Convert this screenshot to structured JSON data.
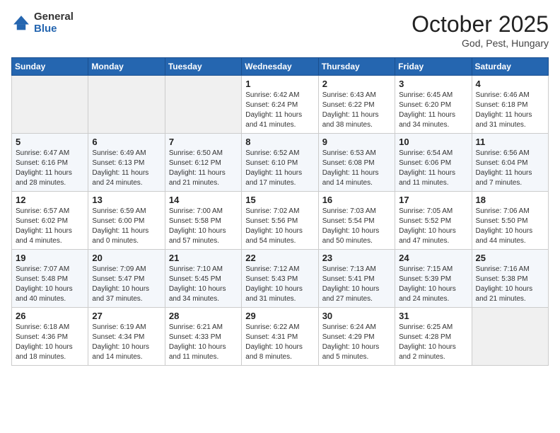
{
  "header": {
    "logo_general": "General",
    "logo_blue": "Blue",
    "month_title": "October 2025",
    "subtitle": "God, Pest, Hungary"
  },
  "calendar": {
    "days_of_week": [
      "Sunday",
      "Monday",
      "Tuesday",
      "Wednesday",
      "Thursday",
      "Friday",
      "Saturday"
    ],
    "weeks": [
      [
        {
          "day": "",
          "info": ""
        },
        {
          "day": "",
          "info": ""
        },
        {
          "day": "",
          "info": ""
        },
        {
          "day": "1",
          "info": "Sunrise: 6:42 AM\nSunset: 6:24 PM\nDaylight: 11 hours\nand 41 minutes."
        },
        {
          "day": "2",
          "info": "Sunrise: 6:43 AM\nSunset: 6:22 PM\nDaylight: 11 hours\nand 38 minutes."
        },
        {
          "day": "3",
          "info": "Sunrise: 6:45 AM\nSunset: 6:20 PM\nDaylight: 11 hours\nand 34 minutes."
        },
        {
          "day": "4",
          "info": "Sunrise: 6:46 AM\nSunset: 6:18 PM\nDaylight: 11 hours\nand 31 minutes."
        }
      ],
      [
        {
          "day": "5",
          "info": "Sunrise: 6:47 AM\nSunset: 6:16 PM\nDaylight: 11 hours\nand 28 minutes."
        },
        {
          "day": "6",
          "info": "Sunrise: 6:49 AM\nSunset: 6:13 PM\nDaylight: 11 hours\nand 24 minutes."
        },
        {
          "day": "7",
          "info": "Sunrise: 6:50 AM\nSunset: 6:12 PM\nDaylight: 11 hours\nand 21 minutes."
        },
        {
          "day": "8",
          "info": "Sunrise: 6:52 AM\nSunset: 6:10 PM\nDaylight: 11 hours\nand 17 minutes."
        },
        {
          "day": "9",
          "info": "Sunrise: 6:53 AM\nSunset: 6:08 PM\nDaylight: 11 hours\nand 14 minutes."
        },
        {
          "day": "10",
          "info": "Sunrise: 6:54 AM\nSunset: 6:06 PM\nDaylight: 11 hours\nand 11 minutes."
        },
        {
          "day": "11",
          "info": "Sunrise: 6:56 AM\nSunset: 6:04 PM\nDaylight: 11 hours\nand 7 minutes."
        }
      ],
      [
        {
          "day": "12",
          "info": "Sunrise: 6:57 AM\nSunset: 6:02 PM\nDaylight: 11 hours\nand 4 minutes."
        },
        {
          "day": "13",
          "info": "Sunrise: 6:59 AM\nSunset: 6:00 PM\nDaylight: 11 hours\nand 0 minutes."
        },
        {
          "day": "14",
          "info": "Sunrise: 7:00 AM\nSunset: 5:58 PM\nDaylight: 10 hours\nand 57 minutes."
        },
        {
          "day": "15",
          "info": "Sunrise: 7:02 AM\nSunset: 5:56 PM\nDaylight: 10 hours\nand 54 minutes."
        },
        {
          "day": "16",
          "info": "Sunrise: 7:03 AM\nSunset: 5:54 PM\nDaylight: 10 hours\nand 50 minutes."
        },
        {
          "day": "17",
          "info": "Sunrise: 7:05 AM\nSunset: 5:52 PM\nDaylight: 10 hours\nand 47 minutes."
        },
        {
          "day": "18",
          "info": "Sunrise: 7:06 AM\nSunset: 5:50 PM\nDaylight: 10 hours\nand 44 minutes."
        }
      ],
      [
        {
          "day": "19",
          "info": "Sunrise: 7:07 AM\nSunset: 5:48 PM\nDaylight: 10 hours\nand 40 minutes."
        },
        {
          "day": "20",
          "info": "Sunrise: 7:09 AM\nSunset: 5:47 PM\nDaylight: 10 hours\nand 37 minutes."
        },
        {
          "day": "21",
          "info": "Sunrise: 7:10 AM\nSunset: 5:45 PM\nDaylight: 10 hours\nand 34 minutes."
        },
        {
          "day": "22",
          "info": "Sunrise: 7:12 AM\nSunset: 5:43 PM\nDaylight: 10 hours\nand 31 minutes."
        },
        {
          "day": "23",
          "info": "Sunrise: 7:13 AM\nSunset: 5:41 PM\nDaylight: 10 hours\nand 27 minutes."
        },
        {
          "day": "24",
          "info": "Sunrise: 7:15 AM\nSunset: 5:39 PM\nDaylight: 10 hours\nand 24 minutes."
        },
        {
          "day": "25",
          "info": "Sunrise: 7:16 AM\nSunset: 5:38 PM\nDaylight: 10 hours\nand 21 minutes."
        }
      ],
      [
        {
          "day": "26",
          "info": "Sunrise: 6:18 AM\nSunset: 4:36 PM\nDaylight: 10 hours\nand 18 minutes."
        },
        {
          "day": "27",
          "info": "Sunrise: 6:19 AM\nSunset: 4:34 PM\nDaylight: 10 hours\nand 14 minutes."
        },
        {
          "day": "28",
          "info": "Sunrise: 6:21 AM\nSunset: 4:33 PM\nDaylight: 10 hours\nand 11 minutes."
        },
        {
          "day": "29",
          "info": "Sunrise: 6:22 AM\nSunset: 4:31 PM\nDaylight: 10 hours\nand 8 minutes."
        },
        {
          "day": "30",
          "info": "Sunrise: 6:24 AM\nSunset: 4:29 PM\nDaylight: 10 hours\nand 5 minutes."
        },
        {
          "day": "31",
          "info": "Sunrise: 6:25 AM\nSunset: 4:28 PM\nDaylight: 10 hours\nand 2 minutes."
        },
        {
          "day": "",
          "info": ""
        }
      ]
    ]
  }
}
